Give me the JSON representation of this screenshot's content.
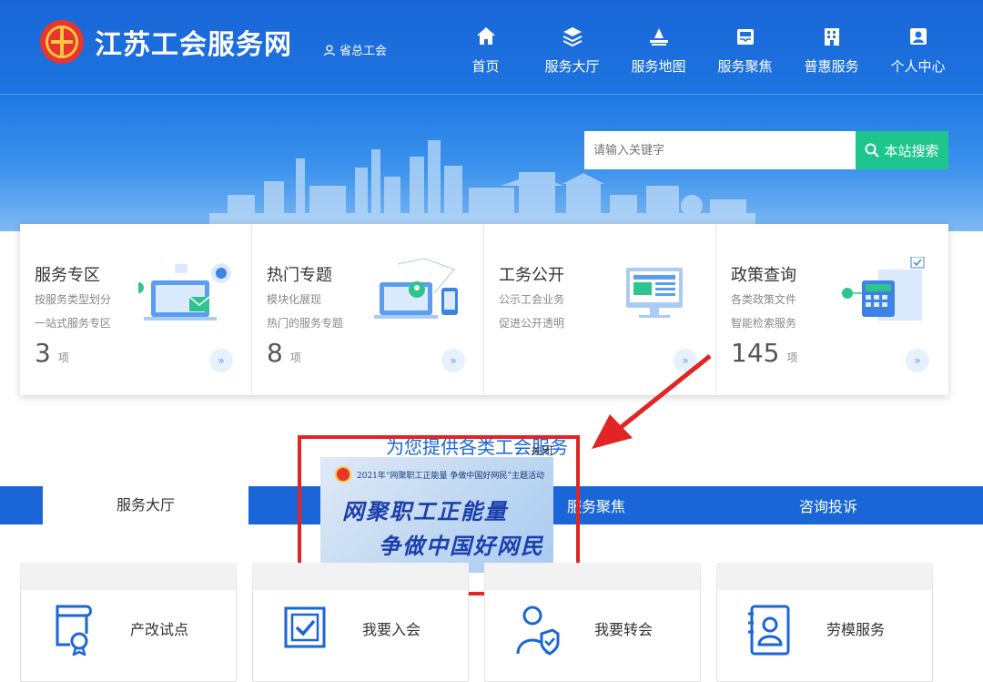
{
  "header": {
    "site_title": "江苏工会服务网",
    "org_link": "省总工会",
    "nav": [
      {
        "label": "首页",
        "icon": "home-icon"
      },
      {
        "label": "服务大厅",
        "icon": "layers-icon"
      },
      {
        "label": "服务地图",
        "icon": "map-icon"
      },
      {
        "label": "服务聚焦",
        "icon": "inbox-icon"
      },
      {
        "label": "普惠服务",
        "icon": "building-icon"
      },
      {
        "label": "个人中心",
        "icon": "user-id-icon"
      }
    ]
  },
  "search": {
    "placeholder": "请输入关键字",
    "button_label": "本站搜索"
  },
  "cards": [
    {
      "title": "服务专区",
      "desc1": "按服务类型划分",
      "desc2": "一站式服务专区",
      "count": "3",
      "unit": "项",
      "more": "»"
    },
    {
      "title": "热门专题",
      "desc1": "模块化展现",
      "desc2": "热门的服务专题",
      "count": "8",
      "unit": "项",
      "more": "»"
    },
    {
      "title": "工务公开",
      "desc1": "公示工会业务",
      "desc2": "促进公开透明",
      "count": "",
      "unit": "",
      "more": "»"
    },
    {
      "title": "政策查询",
      "desc1": "各类政策文件",
      "desc2": "智能检索服务",
      "count": "145",
      "unit": "项",
      "more": "»"
    }
  ],
  "section": {
    "heading": "为您提供各类工会服务",
    "close_label": "关闭"
  },
  "popup": {
    "subtitle": "2021年“网聚职工正能量 争做中国好网民”主题活动",
    "line1": "网聚职工正能量",
    "line2": "争做中国好网民"
  },
  "tabs": [
    {
      "label": "服务大厅",
      "active": true
    },
    {
      "label": "服务聚焦",
      "active": false
    },
    {
      "label": "咨询投诉",
      "active": false
    }
  ],
  "services": [
    {
      "label": "产改试点",
      "icon": "certificate-icon"
    },
    {
      "label": "我要入会",
      "icon": "checkbox-icon"
    },
    {
      "label": "我要转会",
      "icon": "person-shield-icon"
    },
    {
      "label": "劳模服务",
      "icon": "badge-person-icon"
    }
  ],
  "colors": {
    "primary": "#1a66d8",
    "search_button": "#1ec68d",
    "highlight": "#e22424"
  }
}
